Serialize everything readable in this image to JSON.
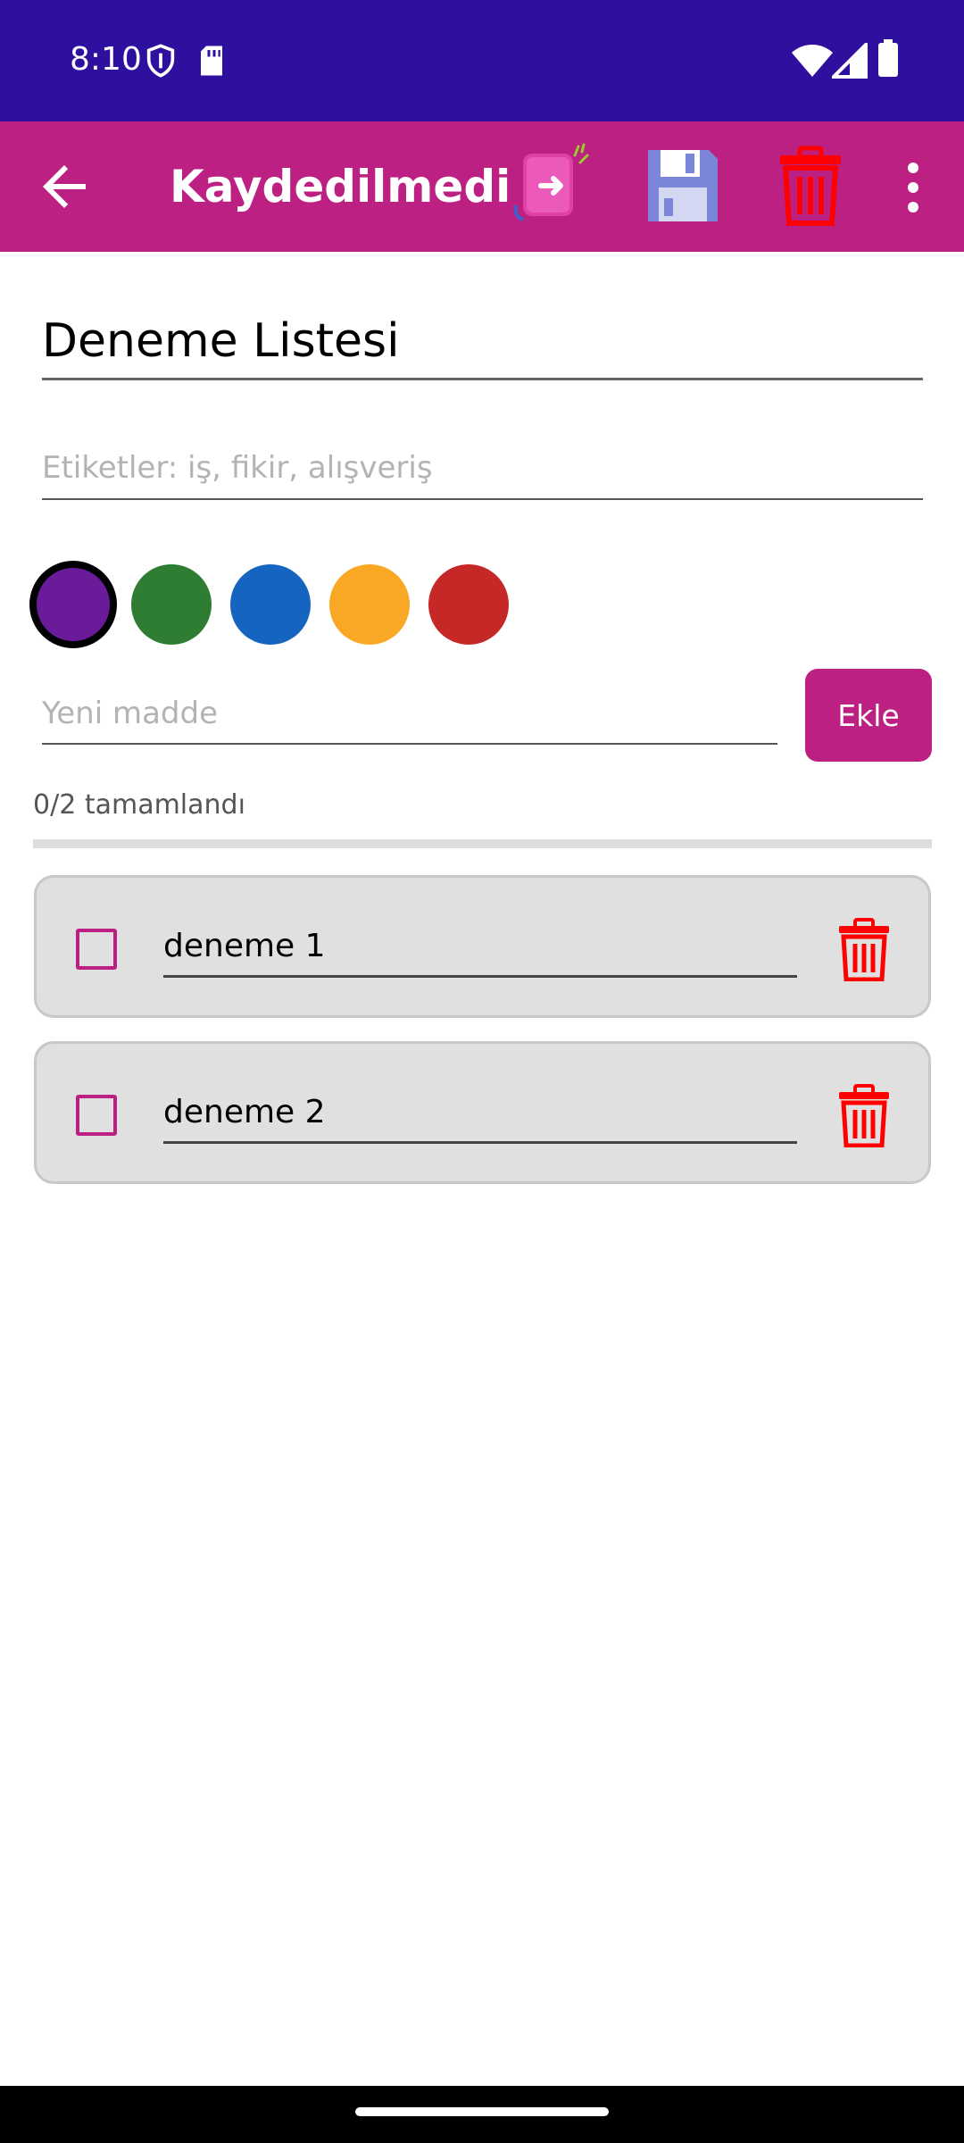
{
  "status_bar": {
    "time": "8:10",
    "icons": [
      "shield-icon",
      "sd-card-icon",
      "wifi-icon",
      "signal-icon",
      "battery-icon"
    ]
  },
  "app_bar": {
    "title": "Kaydedilmedi",
    "color": "#bb2082",
    "actions": [
      "back-arrow-icon",
      "share-export-icon",
      "floppy-save-icon",
      "trash-icon",
      "more-vert-icon"
    ]
  },
  "editor": {
    "title_value": "Deneme Listesi",
    "tags_placeholder": "Etiketler: iş, fikir, alışveriş",
    "colors": [
      "#6a1b9a",
      "#2e7d32",
      "#1565c0",
      "#f9a825",
      "#c62828"
    ],
    "selected_color": "#6a1b9a"
  },
  "new_item": {
    "placeholder": "Yeni madde",
    "add_label": "Ekle"
  },
  "progress": {
    "text": "0/2 tamamlandı",
    "completed": 0,
    "total": 2
  },
  "items": [
    {
      "text": "deneme 1",
      "checked": false
    },
    {
      "text": "deneme 2",
      "checked": false
    }
  ]
}
